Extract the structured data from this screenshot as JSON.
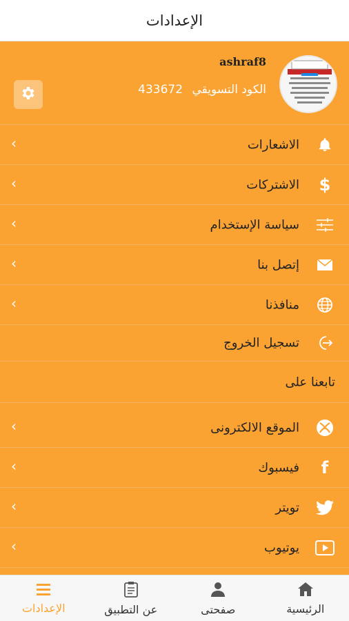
{
  "header": {
    "title": "الإعدادات"
  },
  "profile": {
    "username": "ashraf8",
    "marketing_code_label": "الكود التسويقي",
    "marketing_code_value": "433672",
    "avatar_icon": "profile-avatar-image",
    "settings_icon": "gear-icon"
  },
  "menu": {
    "items": [
      {
        "label": "الاشعارات",
        "icon": "bell-icon"
      },
      {
        "label": "الاشتركات",
        "icon": "dollar-icon"
      },
      {
        "label": "سياسة الإستخدام",
        "icon": "sliders-icon"
      },
      {
        "label": "إتصل بنا",
        "icon": "mail-icon"
      },
      {
        "label": "منافذنا",
        "icon": "globe-icon"
      },
      {
        "label": "تسجيل الخروج",
        "icon": "logout-icon"
      }
    ]
  },
  "follow": {
    "heading": "تابعنا على",
    "items": [
      {
        "label": "الموقع الالكترونى",
        "icon": "xbox-icon"
      },
      {
        "label": "فيسبوك",
        "icon": "facebook-icon"
      },
      {
        "label": "تويتر",
        "icon": "twitter-icon"
      },
      {
        "label": "يوتيوب",
        "icon": "youtube-icon"
      }
    ]
  },
  "tabs": [
    {
      "label": "الرئيسية",
      "icon": "home-icon"
    },
    {
      "label": "صفحتى",
      "icon": "user-icon"
    },
    {
      "label": "عن التطبيق",
      "icon": "clipboard-icon"
    },
    {
      "label": "الإعدادات",
      "icon": "menu-icon",
      "active": true
    }
  ],
  "colors": {
    "accent": "#fba332",
    "header_bg": "#ffffff",
    "tab_bg": "#f7f7f7"
  }
}
